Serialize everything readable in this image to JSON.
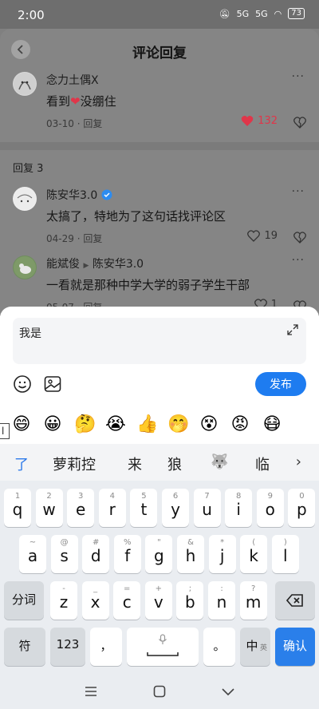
{
  "status": {
    "time": "2:00",
    "signal_1": "5G",
    "signal_2": "5G",
    "battery": "73"
  },
  "header": {
    "title": "评论回复"
  },
  "main_comment": {
    "user": "念力土偶X",
    "text": "看到",
    "text_suffix": "没绷住",
    "date": "03-10",
    "reply_label": "回复",
    "likes": "132",
    "heart_color": "#e0364a"
  },
  "replies_header": "回复 3",
  "replies": [
    {
      "user": "陈安华3.0",
      "verified": true,
      "text": "太搞了，特地为了这句话找评论区",
      "date": "04-29",
      "reply_label": "回复",
      "likes": "19"
    },
    {
      "user": "能斌俊",
      "reply_to": "陈安华3.0",
      "text": "一看就是那种中学大学的弱子学生干部",
      "date": "05-07",
      "reply_label": "回复",
      "likes": "1"
    }
  ],
  "composer": {
    "input_value": "我是",
    "publish_label": "发布",
    "accent": "#1e7cf0"
  },
  "emojis": [
    "😄",
    "😀",
    "🤔",
    "😭",
    "👍",
    "🤭",
    "😵",
    "😡",
    "😷"
  ],
  "cursor_char": "l",
  "candidates": [
    "了",
    "萝莉控",
    "来",
    "狼",
    "🐺",
    "临"
  ],
  "keyboard": {
    "row1": [
      [
        "q",
        "1"
      ],
      [
        "w",
        "2"
      ],
      [
        "e",
        "3"
      ],
      [
        "r",
        "4"
      ],
      [
        "t",
        "5"
      ],
      [
        "y",
        "6"
      ],
      [
        "u",
        "7"
      ],
      [
        "i",
        "8"
      ],
      [
        "o",
        "9"
      ],
      [
        "p",
        "0"
      ]
    ],
    "row2": [
      [
        "a",
        "~"
      ],
      [
        "s",
        "@"
      ],
      [
        "d",
        "#"
      ],
      [
        "f",
        "%"
      ],
      [
        "g",
        "\""
      ],
      [
        "h",
        "&"
      ],
      [
        "j",
        "*"
      ],
      [
        "k",
        "("
      ],
      [
        "l",
        ")"
      ]
    ],
    "row3": [
      [
        "z",
        "-"
      ],
      [
        "x",
        "_"
      ],
      [
        "c",
        "="
      ],
      [
        "v",
        "+"
      ],
      [
        "b",
        ";"
      ],
      [
        "n",
        ":"
      ],
      [
        "m",
        "?"
      ]
    ],
    "fenci": "分词",
    "symbols": "符",
    "numbers": "123",
    "comma": "，",
    "period": "。",
    "lang_main": "中",
    "lang_sub": "英",
    "confirm": "确认",
    "key_accent": "#2a7fea"
  }
}
